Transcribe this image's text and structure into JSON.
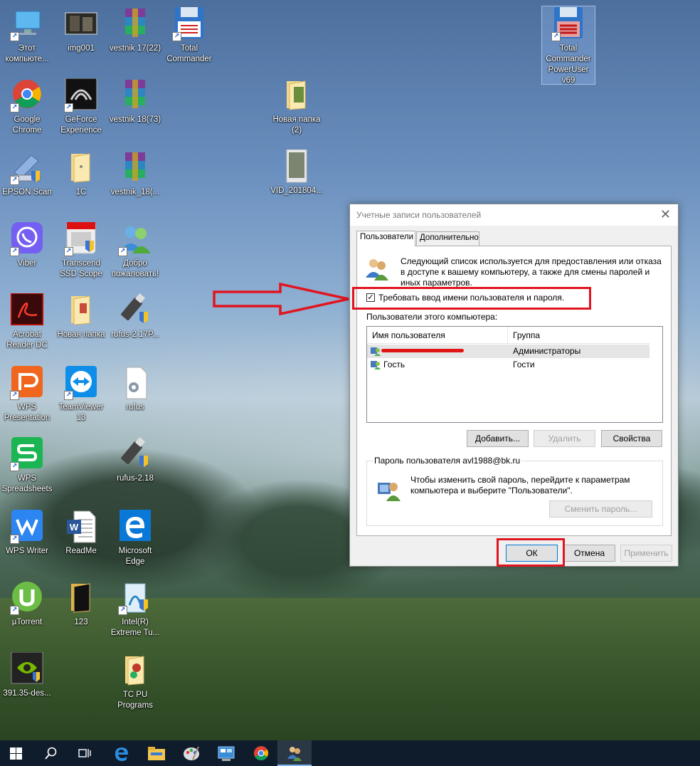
{
  "desktop": {
    "icons": [
      {
        "label": "Этот компьюте..."
      },
      {
        "label": "img001"
      },
      {
        "label": "vestnik 17(22)"
      },
      {
        "label": "Total Commander"
      },
      {
        "label": "Total Commander PowerUser v69"
      },
      {
        "label": "Google Chrome"
      },
      {
        "label": "GeForce Experience"
      },
      {
        "label": "vestnik 18(73)"
      },
      {
        "label": "Новая папка (2)"
      },
      {
        "label": "EPSON Scan"
      },
      {
        "label": "1C"
      },
      {
        "label": "vestnik_18(..."
      },
      {
        "label": "VID_201804..."
      },
      {
        "label": "Viber"
      },
      {
        "label": "Transcend SSD Scope"
      },
      {
        "label": "Добро пожаловать!"
      },
      {
        "label": "Acrobat Reader DC"
      },
      {
        "label": "Новая папка"
      },
      {
        "label": "rufus-2.17P..."
      },
      {
        "label": "WPS Presentation"
      },
      {
        "label": "TeamViewer 13"
      },
      {
        "label": "rufus"
      },
      {
        "label": "WPS Spreadsheets"
      },
      {
        "label": "rufus-2.18"
      },
      {
        "label": "WPS Writer"
      },
      {
        "label": "ReadMe"
      },
      {
        "label": "Microsoft Edge"
      },
      {
        "label": "µTorrent"
      },
      {
        "label": "123"
      },
      {
        "label": "Intel(R) Extreme Tu..."
      },
      {
        "label": "391.35-des..."
      },
      {
        "label": "TC PU Programs"
      }
    ]
  },
  "dialog": {
    "title": "Учетные записи пользователей",
    "tabs": [
      "Пользователи",
      "Дополнительно"
    ],
    "intro": "Следующий список используется для предоставления или отказа в доступе к вашему компьютеру, а также для смены паролей и иных параметров.",
    "require_login_label": "Требовать ввод имени пользователя и пароля.",
    "require_login_checked": true,
    "users_label": "Пользователи этого компьютера:",
    "columns": [
      "Имя пользователя",
      "Группа"
    ],
    "users": [
      {
        "name": "",
        "group": "Администраторы"
      },
      {
        "name": "Гость",
        "group": "Гости"
      }
    ],
    "buttons": {
      "add": "Добавить...",
      "remove": "Удалить",
      "properties": "Свойства",
      "change_password": "Сменить пароль...",
      "ok": "ОК",
      "cancel": "Отмена",
      "apply": "Применить"
    },
    "password_group_caption": "Пароль пользователя avl1988@bk.ru",
    "password_text": "Чтобы изменить свой пароль, перейдите к параметрам компьютера и выберите \"Пользователи\"."
  },
  "taskbar": {
    "items": [
      "start-icon",
      "search-icon",
      "task-view-icon",
      "edge-icon",
      "explorer-icon",
      "paint-icon",
      "control-panel-icon",
      "chrome-icon",
      "users-icon"
    ]
  },
  "colors": {
    "annotation_red": "#e01520",
    "taskbar": "#0f1c2c"
  }
}
